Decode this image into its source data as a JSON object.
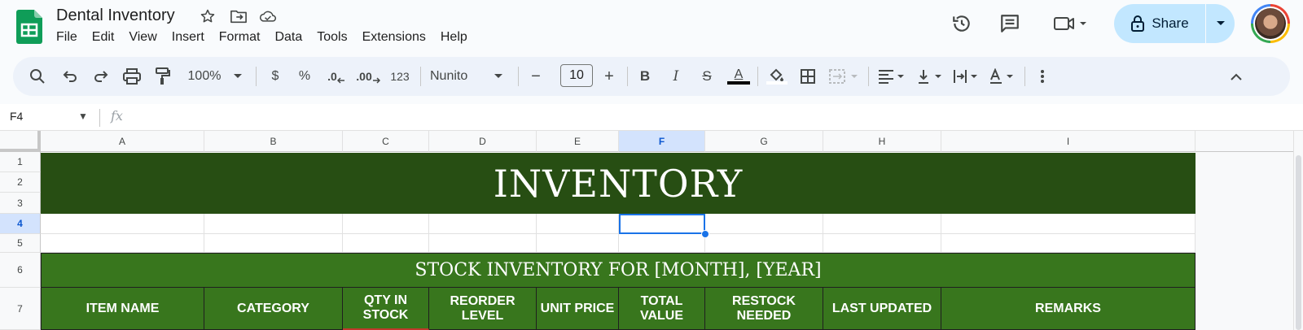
{
  "app": {
    "title": "Dental Inventory",
    "brand_color": "#0f9d58"
  },
  "title_icons": [
    "star-icon",
    "move-to-folder-icon",
    "cloud-saved-icon"
  ],
  "menu": [
    "File",
    "Edit",
    "View",
    "Insert",
    "Format",
    "Data",
    "Tools",
    "Extensions",
    "Help"
  ],
  "top_actions": {
    "history_icon": "history-icon",
    "comments_icon": "comment-icon",
    "meet_icon": "video-camera-icon",
    "share_label": "Share",
    "share_color": "#c2e7ff"
  },
  "toolbar": {
    "zoom": "100%",
    "currency": "$",
    "percent": "%",
    "dec_decrease": ".0",
    "dec_increase": ".00",
    "number_format": "123",
    "font": "Nunito",
    "font_size_minus": "−",
    "font_size": "10",
    "font_size_plus": "+",
    "bold": "B",
    "italic": "I",
    "strike": "S",
    "text_color": "A"
  },
  "formula_bar": {
    "cell_ref": "F4",
    "fx": "fx",
    "value": ""
  },
  "columns": [
    "A",
    "B",
    "C",
    "D",
    "E",
    "F",
    "G",
    "H",
    "I"
  ],
  "rows": [
    "1",
    "2",
    "3",
    "4",
    "5",
    "6",
    "7"
  ],
  "selected": {
    "column": "F",
    "row": "4"
  },
  "sheet": {
    "title": "INVENTORY",
    "title_bg": "#274e13",
    "subtitle": "STOCK INVENTORY FOR [MONTH], [YEAR]",
    "header_bg": "#38761d",
    "headers": [
      "ITEM NAME",
      "CATEGORY",
      "QTY IN STOCK",
      "REORDER LEVEL",
      "UNIT PRICE",
      "TOTAL VALUE",
      "RESTOCK NEEDED",
      "LAST UPDATED",
      "REMARKS"
    ]
  }
}
